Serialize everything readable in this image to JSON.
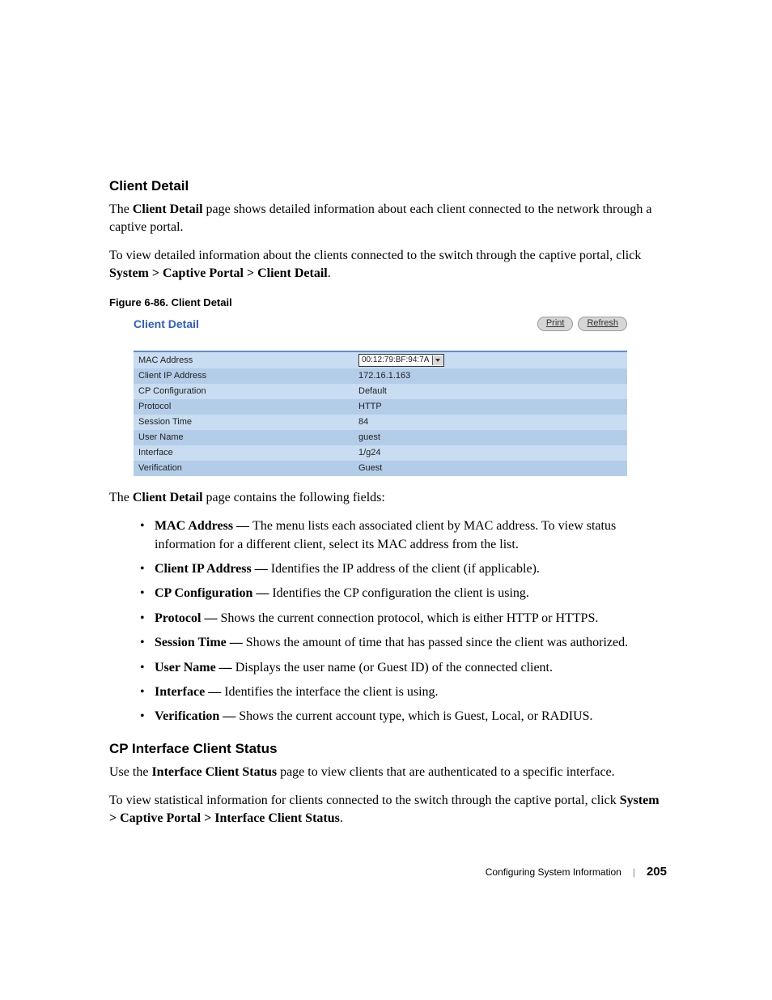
{
  "section1": {
    "heading": "Client Detail",
    "para1_a": "The ",
    "para1_b": "Client Detail",
    "para1_c": " page shows detailed information about each client connected to the network through a captive portal.",
    "para2_a": "To view detailed information about the clients connected to the switch through the captive portal, click ",
    "para2_b": "System > Captive Portal > Client Detail",
    "para2_c": "."
  },
  "figure": {
    "caption": "Figure 6-86.    Client Detail",
    "title": "Client Detail",
    "print": "Print",
    "refresh": "Refresh",
    "rows": [
      {
        "label": "MAC Address",
        "value": "00:12:79:BF:94:7A"
      },
      {
        "label": "Client IP Address",
        "value": "172.16.1.163"
      },
      {
        "label": "CP Configuration",
        "value": "Default"
      },
      {
        "label": "Protocol",
        "value": "HTTP"
      },
      {
        "label": "Session Time",
        "value": "84"
      },
      {
        "label": "User Name",
        "value": "guest"
      },
      {
        "label": "Interface",
        "value": "1/g24"
      },
      {
        "label": "Verification",
        "value": "Guest"
      }
    ]
  },
  "fields_intro_a": "The ",
  "fields_intro_b": "Client Detail",
  "fields_intro_c": " page contains the following fields:",
  "fields": [
    {
      "term": "MAC Address — ",
      "desc": "The menu lists each associated client by MAC address. To view status information for a different client, select its MAC address from the list."
    },
    {
      "term": "Client IP Address — ",
      "desc": "Identifies the IP address of the client (if applicable)."
    },
    {
      "term": "CP Configuration — ",
      "desc": "Identifies the CP configuration the client is using."
    },
    {
      "term": "Protocol — ",
      "desc": "Shows the current connection protocol, which is either HTTP or HTTPS."
    },
    {
      "term": "Session Time — ",
      "desc": "Shows the amount of time that has passed since the client was authorized."
    },
    {
      "term": "User Name — ",
      "desc": "Displays the user name (or Guest ID) of the connected client."
    },
    {
      "term": "Interface — ",
      "desc": "Identifies the interface the client is using."
    },
    {
      "term": "Verification — ",
      "desc": "Shows the current account type, which is Guest, Local, or RADIUS."
    }
  ],
  "section2": {
    "heading": "CP Interface Client Status",
    "para1_a": "Use the ",
    "para1_b": "Interface Client Status",
    "para1_c": " page to view clients that are authenticated to a specific interface.",
    "para2_a": "To view statistical information for clients connected to the switch through the captive portal, click ",
    "para2_b": "System > Captive Portal > Interface Client Status",
    "para2_c": "."
  },
  "footer": {
    "text": "Configuring System Information",
    "page": "205"
  }
}
